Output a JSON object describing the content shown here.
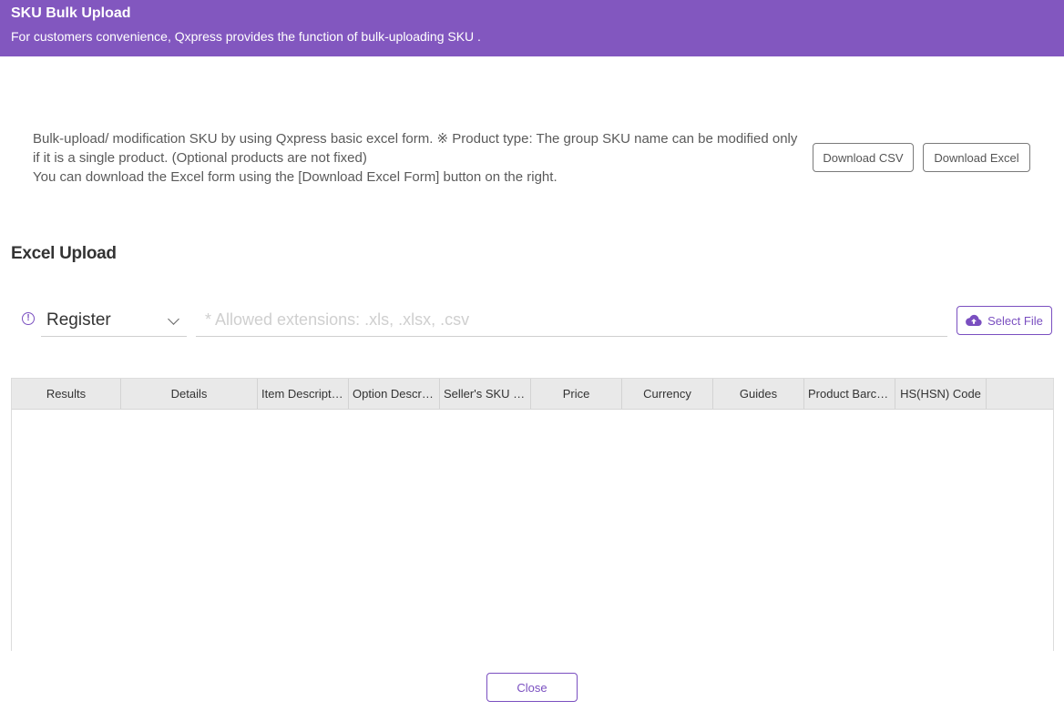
{
  "header": {
    "title": "SKU Bulk Upload",
    "subtitle": "For customers convenience, Qxpress provides the function of bulk-uploading SKU ."
  },
  "info": {
    "line1": "Bulk-upload/ modification SKU by using Qxpress basic excel form. ※ Product type: The group SKU name can be modified only if it is a single product. (Optional products are not fixed)",
    "line2": "You can download the Excel form using the [Download Excel Form] button on the right."
  },
  "buttons": {
    "download_csv": "Download CSV",
    "download_excel": "Download Excel",
    "select_file": "Select File",
    "close": "Close"
  },
  "upload": {
    "section_title": "Excel Upload",
    "notice_icon_glyph": "!",
    "mode_selected": "Register",
    "file_placeholder": "* Allowed extensions: .xls, .xlsx, .csv"
  },
  "grid": {
    "columns": [
      "Results",
      "Details",
      "Item Description",
      "Option Description",
      "Seller's SKU Code",
      "Price",
      "Currency",
      "Guides",
      "Product Barcode",
      "HS(HSN) Code"
    ],
    "rows": []
  },
  "colors": {
    "brand": "#8257bf",
    "accent": "#7a4fc0"
  },
  "icons": {
    "notice": "exclamation-circle-icon",
    "dropdown": "chevron-down-icon",
    "upload": "cloud-upload-icon"
  }
}
